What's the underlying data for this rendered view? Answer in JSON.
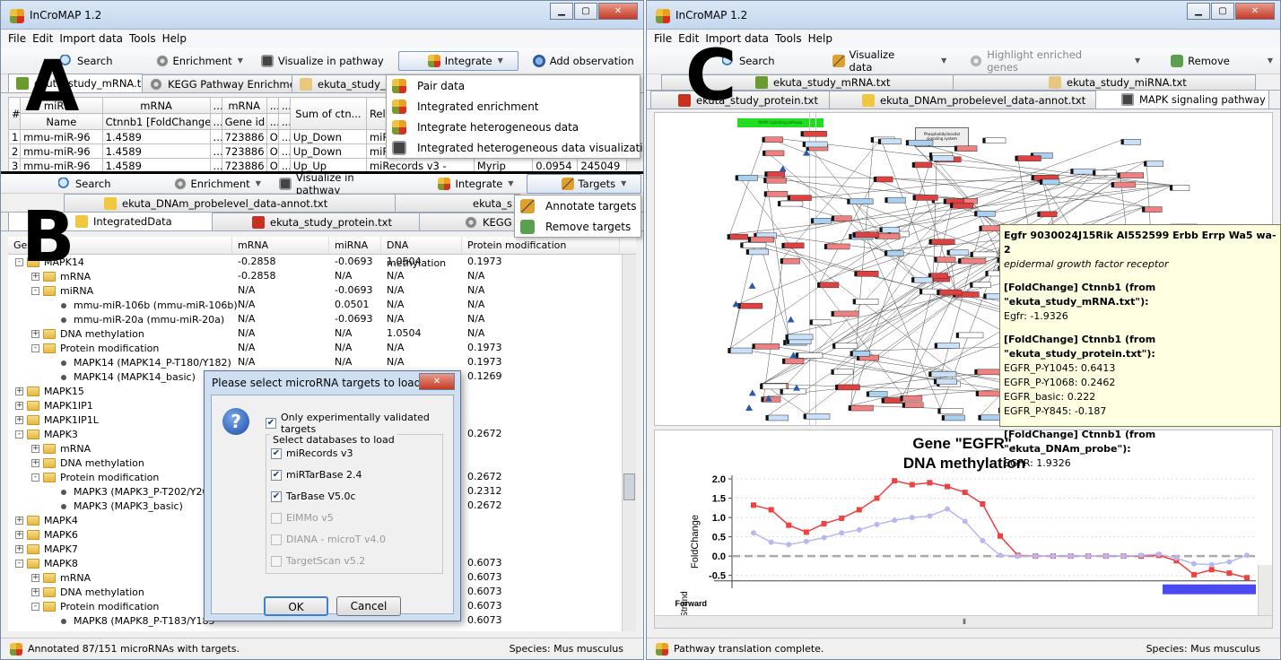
{
  "left": {
    "title": "InCroMAP 1.2",
    "menu": [
      "File",
      "Edit",
      "Import data",
      "Tools",
      "Help"
    ],
    "toolbar": {
      "search": "Search",
      "enrichment": "Enrichment",
      "visualize": "Visualize in pathway",
      "integrate": "Integrate",
      "add": "Add observation"
    },
    "tabs_a": [
      "ekuta_study_mRNA.txt",
      "KEGG Pathway Enrichment",
      "ekuta_study_m"
    ],
    "integrate_menu": [
      "Pair data",
      "Integrated enrichment",
      "Integrate heterogeneous data",
      "Integrated heterogeneous data visualization"
    ],
    "table": {
      "h1": [
        "#",
        "miRNA",
        "mRNA",
        "...",
        "mRNA",
        "...",
        "...",
        "Sum of ctn...",
        "Relation"
      ],
      "h2": [
        "",
        "Name",
        "Ctnnb1 [FoldChange]",
        "...",
        "Gene id",
        "...",
        "..."
      ],
      "rows": [
        [
          "1",
          "mmu-miR-96",
          "1.4589",
          "...",
          "723886",
          "OD",
          "...",
          "Up_Down",
          "miRecords"
        ],
        [
          "2",
          "mmu-miR-96",
          "1.4589",
          "...",
          "723886",
          "OD",
          "...",
          "Up_Down",
          "miRecords"
        ],
        [
          "3",
          "mmu-miR-96",
          "1.4589",
          "...",
          "723886",
          "OD",
          "...",
          "Up_Up",
          "miRecords v3 -",
          "Myrip",
          "0.0954",
          "245049"
        ]
      ]
    },
    "toolbar_b": {
      "search": "Search",
      "enrichment": "Enrichment",
      "visualize": "Visualize in pathway",
      "integrate": "Integrate",
      "targets": "Targets"
    },
    "tabs_b1": [
      "ekuta_DNAm_probelevel_data-annot.txt",
      "ekuta_s"
    ],
    "tabs_b2": [
      "IntegratedData",
      "ekuta_study_protein.txt",
      "KEGG P"
    ],
    "targets_menu": [
      "Annotate targets",
      "Remove targets"
    ],
    "tree_cols": [
      "Gene",
      "mRNA",
      "miRNA",
      "DNA methylation",
      "Protein modification"
    ],
    "tree": [
      {
        "lv": 0,
        "t": "f",
        "e": "-",
        "n": "MAPK14",
        "v": [
          "-0.2858",
          "-0.0693",
          "1.0504",
          "0.1973"
        ]
      },
      {
        "lv": 1,
        "t": "f",
        "e": "+",
        "n": "mRNA",
        "v": [
          "-0.2858",
          "N/A",
          "N/A",
          "N/A"
        ]
      },
      {
        "lv": 1,
        "t": "f",
        "e": "-",
        "n": "miRNA",
        "v": [
          "N/A",
          "-0.0693",
          "N/A",
          "N/A"
        ]
      },
      {
        "lv": 2,
        "t": "l",
        "e": "",
        "n": "mmu-miR-106b (mmu-miR-106b)",
        "v": [
          "N/A",
          "0.0501",
          "N/A",
          "N/A"
        ]
      },
      {
        "lv": 2,
        "t": "l",
        "e": "",
        "n": "mmu-miR-20a (mmu-miR-20a)",
        "v": [
          "N/A",
          "-0.0693",
          "N/A",
          "N/A"
        ]
      },
      {
        "lv": 1,
        "t": "f",
        "e": "+",
        "n": "DNA methylation",
        "v": [
          "N/A",
          "N/A",
          "1.0504",
          "N/A"
        ]
      },
      {
        "lv": 1,
        "t": "f",
        "e": "-",
        "n": "Protein modification",
        "v": [
          "N/A",
          "N/A",
          "N/A",
          "0.1973"
        ]
      },
      {
        "lv": 2,
        "t": "l",
        "e": "",
        "n": "MAPK14 (MAPK14_P-T180/Y182)",
        "v": [
          "N/A",
          "N/A",
          "N/A",
          "0.1973"
        ]
      },
      {
        "lv": 2,
        "t": "l",
        "e": "",
        "n": "MAPK14 (MAPK14_basic)",
        "v": [
          "",
          "",
          "",
          "0.1269"
        ]
      },
      {
        "lv": 0,
        "t": "f",
        "e": "+",
        "n": "MAPK15",
        "v": [
          "",
          "",
          "",
          ""
        ]
      },
      {
        "lv": 0,
        "t": "f",
        "e": "+",
        "n": "MAPK1IP1",
        "v": [
          "",
          "",
          "",
          ""
        ]
      },
      {
        "lv": 0,
        "t": "f",
        "e": "+",
        "n": "MAPK1IP1L",
        "v": [
          "",
          "",
          "",
          ""
        ]
      },
      {
        "lv": 0,
        "t": "f",
        "e": "-",
        "n": "MAPK3",
        "v": [
          "",
          "",
          "",
          "0.2672"
        ]
      },
      {
        "lv": 1,
        "t": "f",
        "e": "+",
        "n": "mRNA",
        "v": [
          "",
          "",
          "",
          ""
        ]
      },
      {
        "lv": 1,
        "t": "f",
        "e": "+",
        "n": "DNA methylation",
        "v": [
          "",
          "",
          "",
          ""
        ]
      },
      {
        "lv": 1,
        "t": "f",
        "e": "-",
        "n": "Protein modification",
        "v": [
          "",
          "",
          "",
          "0.2672"
        ]
      },
      {
        "lv": 2,
        "t": "l",
        "e": "",
        "n": "MAPK3 (MAPK3_P-T202/Y204",
        "v": [
          "",
          "",
          "",
          "0.2312"
        ]
      },
      {
        "lv": 2,
        "t": "l",
        "e": "",
        "n": "MAPK3 (MAPK3_basic)",
        "v": [
          "",
          "",
          "",
          "0.2672"
        ]
      },
      {
        "lv": 0,
        "t": "f",
        "e": "+",
        "n": "MAPK4",
        "v": [
          "",
          "",
          "",
          ""
        ]
      },
      {
        "lv": 0,
        "t": "f",
        "e": "+",
        "n": "MAPK6",
        "v": [
          "",
          "",
          "",
          ""
        ]
      },
      {
        "lv": 0,
        "t": "f",
        "e": "+",
        "n": "MAPK7",
        "v": [
          "",
          "",
          "",
          ""
        ]
      },
      {
        "lv": 0,
        "t": "f",
        "e": "-",
        "n": "MAPK8",
        "v": [
          "",
          "",
          "",
          "0.6073"
        ]
      },
      {
        "lv": 1,
        "t": "f",
        "e": "+",
        "n": "mRNA",
        "v": [
          "",
          "",
          "",
          "0.6073"
        ]
      },
      {
        "lv": 1,
        "t": "f",
        "e": "+",
        "n": "DNA methylation",
        "v": [
          "",
          "",
          "",
          "0.6073"
        ]
      },
      {
        "lv": 1,
        "t": "f",
        "e": "-",
        "n": "Protein modification",
        "v": [
          "",
          "",
          "",
          "0.6073"
        ]
      },
      {
        "lv": 2,
        "t": "l",
        "e": "",
        "n": "MAPK8 (MAPK8_P-T183/Y185",
        "v": [
          "",
          "",
          "",
          "0.6073"
        ]
      }
    ],
    "dialog": {
      "title": "Please select microRNA targets to load.",
      "validated": "Only experimentally validated targets",
      "group": "Select databases to load",
      "dbs": [
        {
          "n": "miRecords v3",
          "on": true
        },
        {
          "n": "miRTarBase 2.4",
          "on": true
        },
        {
          "n": "TarBase V5.0c",
          "on": true
        },
        {
          "n": "ElMMo v5",
          "on": false
        },
        {
          "n": "DIANA - microT v4.0",
          "on": false
        },
        {
          "n": "TargetScan v5.2",
          "on": false
        }
      ],
      "ok": "OK",
      "cancel": "Cancel"
    },
    "status": "Annotated 87/151 microRNAs with targets.",
    "species": "Species: Mus musculus",
    "labels": [
      "A",
      "B"
    ]
  },
  "right": {
    "title": "InCroMAP 1.2",
    "menu": [
      "File",
      "Edit",
      "Import data",
      "Tools",
      "Help"
    ],
    "toolbar": {
      "search": "Search",
      "visualize": "Visualize data",
      "highlight": "Highlight enriched genes",
      "remove": "Remove"
    },
    "tabs1": [
      "ekuta_study_mRNA.txt",
      "ekuta_study_miRNA.txt"
    ],
    "tabs2": [
      "ekuta_study_protein.txt",
      "ekuta_DNAm_probelevel_data-annot.txt",
      "MAPK signaling pathway"
    ],
    "pathway_title": "MAPK signaling pathway",
    "pathway_box": "Phosphatidylinositol signaling system",
    "tooltip": {
      "l1": "Egfr 9030024J15Rik AI552599 Erbb Errp Wa5 wa-2",
      "l2": "epidermal growth factor receptor",
      "s1": "[FoldChange] Ctnnb1 (from \"ekuta_study_mRNA.txt\"):",
      "s1v": [
        "Egfr: -1.9326"
      ],
      "s2": "[FoldChange] Ctnnb1 (from \"ekuta_study_protein.txt\"):",
      "s2v": [
        "EGFR_P-Y1045: 0.6413",
        "EGFR_P-Y1068: 0.2462",
        "EGFR_basic: 0.222",
        "EGFR_P-Y845: -0.187"
      ],
      "s3": "[FoldChange] Ctnnb1 (from \"ekuta_DNAm_probe\"):",
      "s3v": [
        "EGFR: 1.9326"
      ]
    },
    "status": "Pathway translation complete.",
    "species": "Species: Mus musculus",
    "label": "C",
    "strand": "Strand",
    "forward": "Forward"
  },
  "chart_data": {
    "type": "line",
    "title": "Gene \"EGFR\".\nDNA methylation",
    "title_lines": [
      "Gene \"EGFR\".",
      "DNA methylation"
    ],
    "ylabel": "FoldChange",
    "xlabel": "",
    "ylim": [
      -0.6,
      2.0
    ],
    "yticks": [
      "2.0",
      "1.5",
      "1.0",
      "0.5",
      "0.0",
      "-0.5"
    ],
    "grid": true,
    "reference_line": 0.0,
    "series": [
      {
        "color": "#f04040",
        "values": [
          1.32,
          1.2,
          0.8,
          0.62,
          0.84,
          0.98,
          1.2,
          1.5,
          1.95,
          1.85,
          1.9,
          1.8,
          1.65,
          1.35,
          0.52,
          0.02,
          0.0,
          0.0,
          0.0,
          0.0,
          0.0,
          0.0,
          0.0,
          0.02,
          -0.12,
          -0.48,
          -0.35,
          -0.44,
          -0.56
        ]
      },
      {
        "color": "#b8b8f0",
        "values": [
          0.6,
          0.36,
          0.3,
          0.38,
          0.48,
          0.6,
          0.68,
          0.82,
          0.93,
          1.0,
          1.04,
          1.22,
          0.9,
          0.4,
          0.02,
          0.0,
          0.0,
          0.0,
          0.0,
          0.0,
          0.0,
          0.0,
          0.02,
          0.05,
          -0.05,
          -0.2,
          -0.22,
          -0.15,
          0.02
        ]
      }
    ]
  }
}
